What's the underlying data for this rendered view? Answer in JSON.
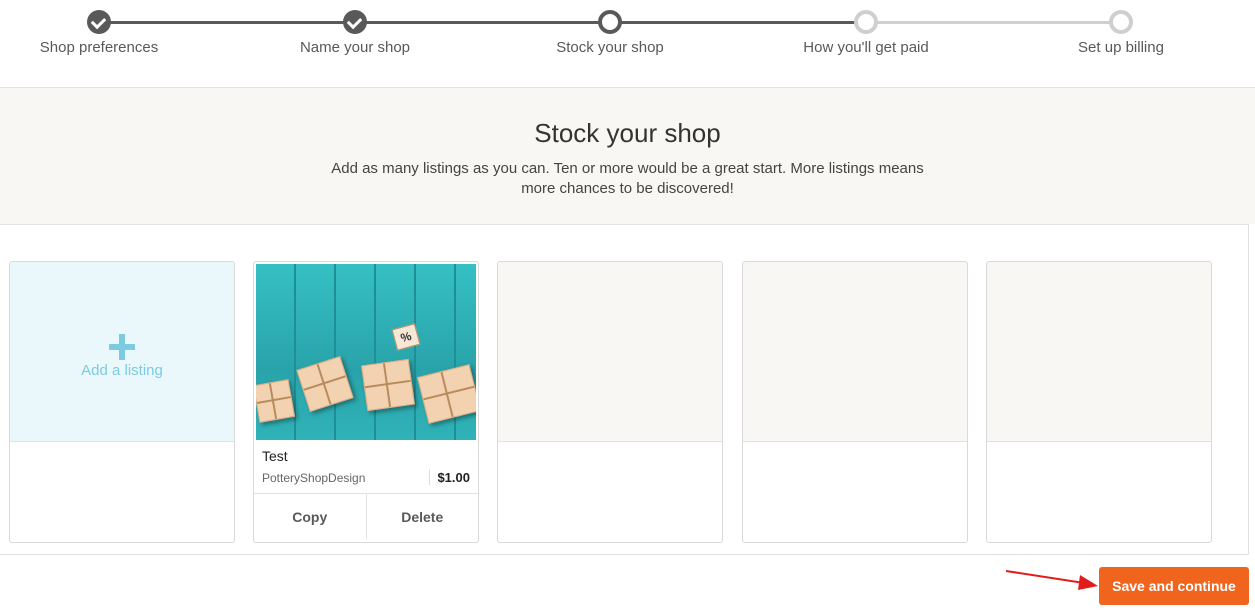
{
  "stepper": {
    "steps": [
      {
        "label": "Shop preferences",
        "state": "done"
      },
      {
        "label": "Name your shop",
        "state": "done"
      },
      {
        "label": "Stock your shop",
        "state": "current"
      },
      {
        "label": "How you'll get paid",
        "state": "todo"
      },
      {
        "label": "Set up billing",
        "state": "todo"
      }
    ]
  },
  "hero": {
    "title": "Stock your shop",
    "description": "Add as many listings as you can. Ten or more would be a great start. More listings means more chances to be discovered!"
  },
  "add_listing": {
    "label": "Add a listing",
    "icon": "plus-icon"
  },
  "listing": {
    "title": "Test",
    "shop_name": "PotteryShopDesign",
    "price": "$1.00",
    "copy_label": "Copy",
    "delete_label": "Delete",
    "image": "turquoise wooden planks with small kraft-paper gift boxes and a percent tag"
  },
  "footer": {
    "save_label": "Save and continue"
  },
  "colors": {
    "accent": "#f1641e",
    "step_done": "#595959",
    "step_todo": "#cfcfcf",
    "add_tile": "#eaf8fb",
    "add_text": "#7ccbe0",
    "hero_bg": "#f8f7f3",
    "annotation_arrow": "#e41b1b"
  }
}
